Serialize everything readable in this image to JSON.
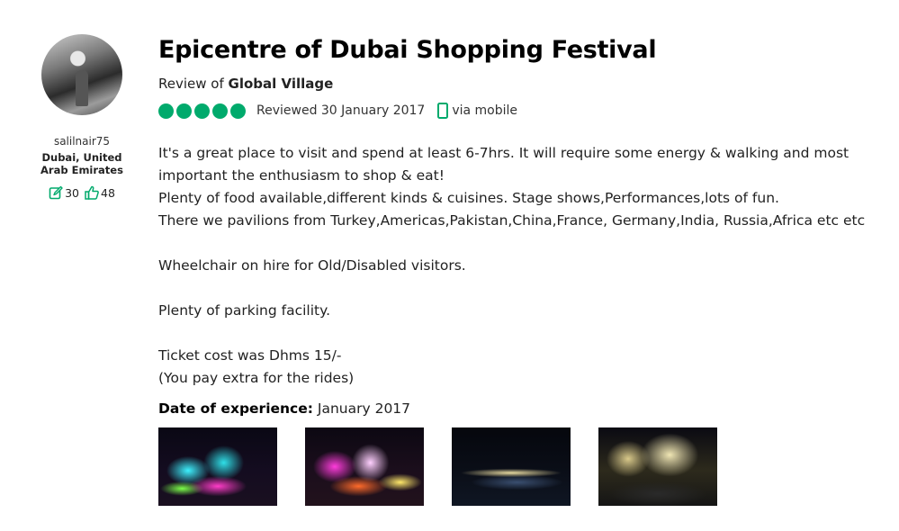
{
  "reviewer": {
    "username": "salilnair75",
    "location": "Dubai, United Arab Emirates",
    "contributions": "30",
    "helpful_votes": "48"
  },
  "review": {
    "title": "Epicentre of Dubai Shopping Festival",
    "review_of_prefix": "Review of ",
    "attraction": "Global Village",
    "rating": 5,
    "reviewed_date": "Reviewed 30 January 2017",
    "via": "via mobile",
    "body": {
      "line1": "It's a great place to visit and spend at least 6-7hrs. It will require some energy & walking and most",
      "line2": "important the enthusiasm to shop & eat!",
      "line3": "Plenty of food available,different kinds & cuisines. Stage shows,Performances,lots of fun.",
      "line4": "There we pavilions from Turkey,Americas,Pakistan,China,France, Germany,India, Russia,Africa etc etc",
      "line5": "Wheelchair on hire for Old/Disabled visitors.",
      "line6": "Plenty of parking facility.",
      "line7": "Ticket cost was Dhms 15/-",
      "line8": "(You pay extra for the rides)"
    },
    "date_of_experience_label": "Date of experience:",
    "date_of_experience": "January 2017"
  },
  "colors": {
    "brand_green": "#00aa6c"
  },
  "icons": {
    "contributions": "pencil-square-icon",
    "helpful": "thumbs-up-icon",
    "mobile": "mobile-phone-icon"
  }
}
